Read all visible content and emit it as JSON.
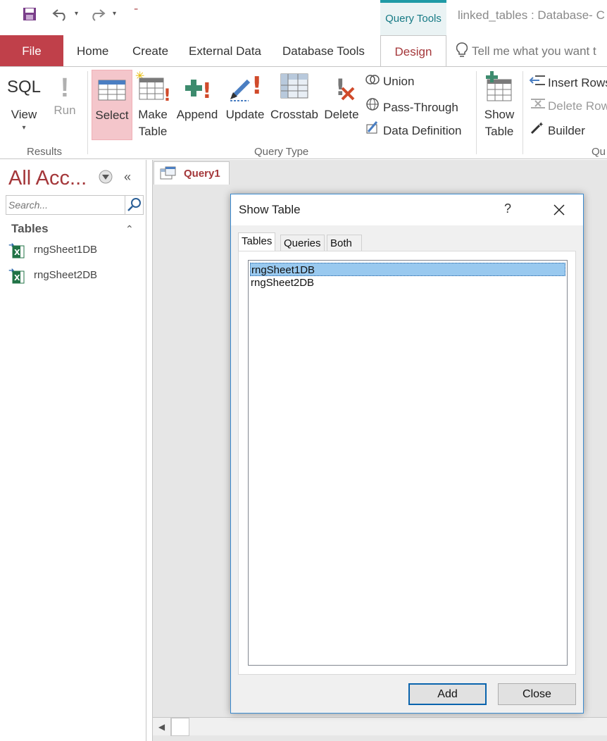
{
  "qat": {
    "save_icon": "save-icon",
    "undo_icon": "undo-icon",
    "redo_icon": "redo-icon",
    "customize_icon": "customize-qat-icon"
  },
  "context_tab": "Query Tools",
  "window_title": "linked_tables : Database- C",
  "tabs": [
    "File",
    "Home",
    "Create",
    "External Data",
    "Database Tools",
    "Design"
  ],
  "active_tab": "Design",
  "tell_me": "Tell me what you want t",
  "ribbon": {
    "results": {
      "label": "Results",
      "view_icon_text": "SQL",
      "view": "View",
      "run": "Run"
    },
    "query_type": {
      "label": "Query Type",
      "select": "Select",
      "make_table_1": "Make",
      "make_table_2": "Table",
      "append": "Append",
      "update": "Update",
      "crosstab": "Crosstab",
      "delete": "Delete",
      "union": "Union",
      "pass_through": "Pass-Through",
      "data_definition": "Data Definition"
    },
    "query_setup": {
      "label": "Qu",
      "show_table_1": "Show",
      "show_table_2": "Table",
      "insert_rows": "Insert Rows",
      "delete_rows": "Delete Rows",
      "builder": "Builder"
    }
  },
  "nav": {
    "title": "All Acc...",
    "search_placeholder": "Search...",
    "section": "Tables",
    "items": [
      "rngSheet1DB",
      "rngSheet2DB"
    ]
  },
  "document": {
    "tab_label": "Query1"
  },
  "dialog": {
    "title": "Show Table",
    "help": "?",
    "tabs": [
      "Tables",
      "Queries",
      "Both"
    ],
    "active_tab": "Tables",
    "list": [
      "rngSheet1DB",
      "rngSheet2DB"
    ],
    "selected": "rngSheet1DB",
    "add": "Add",
    "close": "Close"
  },
  "colors": {
    "accent": "#a4373a",
    "file_tab": "#c0404a",
    "context": "#1f9aa6",
    "selection": "#99c9ef"
  }
}
